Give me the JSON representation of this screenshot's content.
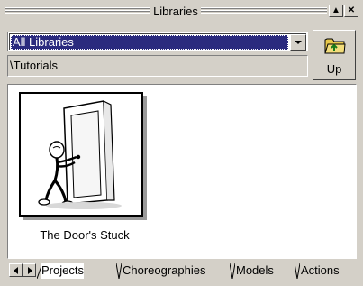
{
  "window": {
    "title": "Libraries"
  },
  "library_select": {
    "selected": "All Libraries"
  },
  "path": {
    "value": "\\Tutorials"
  },
  "up_button": {
    "label": "Up",
    "icon": "folder-up-icon"
  },
  "items": [
    {
      "caption": "The Door's Stuck",
      "icon": "door-figure-thumbnail"
    }
  ],
  "tabs": [
    {
      "label": "Projects",
      "active": true
    },
    {
      "label": "Choreographies",
      "active": false
    },
    {
      "label": "Models",
      "active": false
    },
    {
      "label": "Actions",
      "active": false
    }
  ],
  "colors": {
    "selection_bg": "#2a2a7e",
    "face": "#d4d0c8",
    "folder": "#e8c84a"
  }
}
